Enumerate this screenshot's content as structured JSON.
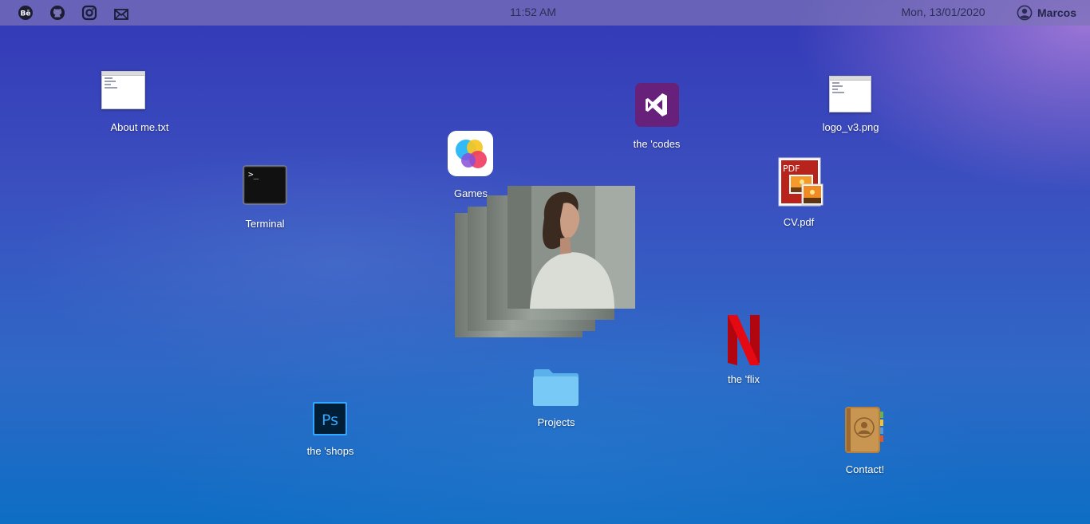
{
  "topbar": {
    "social_icons": [
      {
        "name": "behance-icon"
      },
      {
        "name": "github-icon"
      },
      {
        "name": "instagram-icon"
      },
      {
        "name": "mail-icon"
      }
    ],
    "time": "11:52 AM",
    "date": "Mon, 13/01/2020",
    "user_name": "Marcos",
    "user_icon": "user-circle-icon"
  },
  "desktop": {
    "about": {
      "label": "About me.txt",
      "icon": "text-document-icon"
    },
    "terminal": {
      "label": "Terminal",
      "icon": "terminal-icon",
      "prompt": ">_"
    },
    "games": {
      "label": "Games",
      "icon": "game-center-icon"
    },
    "codes": {
      "label": "the 'codes",
      "icon": "visual-studio-icon"
    },
    "logo": {
      "label": "logo_v3.png",
      "icon": "image-document-icon"
    },
    "cv": {
      "label": "CV.pdf",
      "icon": "pdf-icon",
      "badge": "PDF"
    },
    "flix": {
      "label": "the 'flix",
      "icon": "netflix-icon"
    },
    "projects": {
      "label": "Projects",
      "icon": "folder-icon"
    },
    "shops": {
      "label": "the 'shops",
      "icon": "photoshop-icon",
      "badge": "Ps"
    },
    "contact": {
      "label": "Contact!",
      "icon": "contacts-book-icon"
    }
  },
  "colors": {
    "topbar": "#7d73b9",
    "codes_bg": "#68217a",
    "netflix_red": "#e50914",
    "ps_bg": "#001e36",
    "ps_blue": "#31a8ff",
    "folder": "#6cc0f5"
  }
}
